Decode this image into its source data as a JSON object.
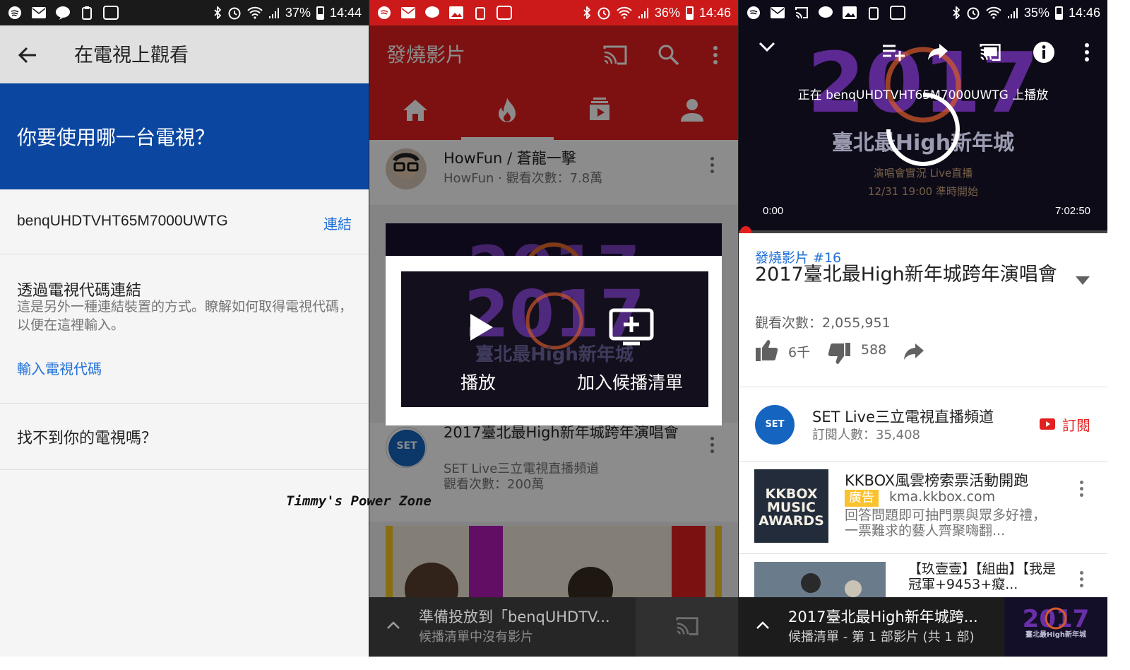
{
  "watermark": "Timmy's Power Zone",
  "panel1": {
    "status": {
      "battery": "37%",
      "time": "14:44"
    },
    "title": "在電視上觀看",
    "question": "你要使用哪一台電視？",
    "device_name": "benqUHDTVHT65M7000UWTG",
    "connect_label": "連結",
    "code_heading": "透過電視代碼連結",
    "code_desc": "這是另外一種連結裝置的方式。瞭解如何取得電視代碼，以便在這裡輸入。",
    "code_link": "輸入電視代碼",
    "find_tv": "找不到你的電視嗎？"
  },
  "panel2": {
    "status": {
      "battery": "36%",
      "time": "14:46"
    },
    "app_title": "發燒影片",
    "row1_title": "HowFun / 蒼龍一擊",
    "row1_sub": "HowFun · 觀看次數：7.8萬",
    "row2_title": "2017臺北最High新年城跨年演唱會",
    "row2_channel": "SET Live三立電視直播頻道",
    "row2_views": "觀看次數：200萬",
    "dialog_play": "播放",
    "dialog_add": "加入候播清單",
    "mini_title": "準備投放到「benqUHDTV...",
    "mini_sub": "候播清單中沒有影片"
  },
  "panel3": {
    "status": {
      "battery": "35%",
      "time": "14:46"
    },
    "casting_text": "正在 benqUHDTVHT65M7000UWTG 上播放",
    "time_start": "0:00",
    "time_end": "7:02:50",
    "channel_tag": "發燒影片 #16",
    "video_title": "2017臺北最High新年城跨年演唱會",
    "views": "觀看次數：2,055,951",
    "likes": "6千",
    "dislikes": "588",
    "channel_name": "SET Live三立電視直播頻道",
    "subscribers": "訂閱人數：35,408",
    "subscribe_label": "訂閱",
    "ad_title": "KKBOX風雲榜索票活動開跑",
    "ad_badge": "廣告",
    "ad_url": "kma.kkbox.com",
    "ad_desc": "回答問題即可抽門票與眾多好禮，一票難求的藝人齊聚嗨翻...",
    "ad_logo": "KKBOX MUSIC AWARDS",
    "video2_title": "【玖壹壹】【組曲】【我是冠軍+9453+癡...",
    "mini_title": "2017臺北最High新年城跨...",
    "mini_sub": "候播清單 - 第 1 部影片 (共 1 部)"
  },
  "colors": {
    "youtube_red": "#e32020",
    "link_blue": "#1e6fd9",
    "dialog_blue": "#0b47a1",
    "ad_yellow": "#f9c22e"
  }
}
